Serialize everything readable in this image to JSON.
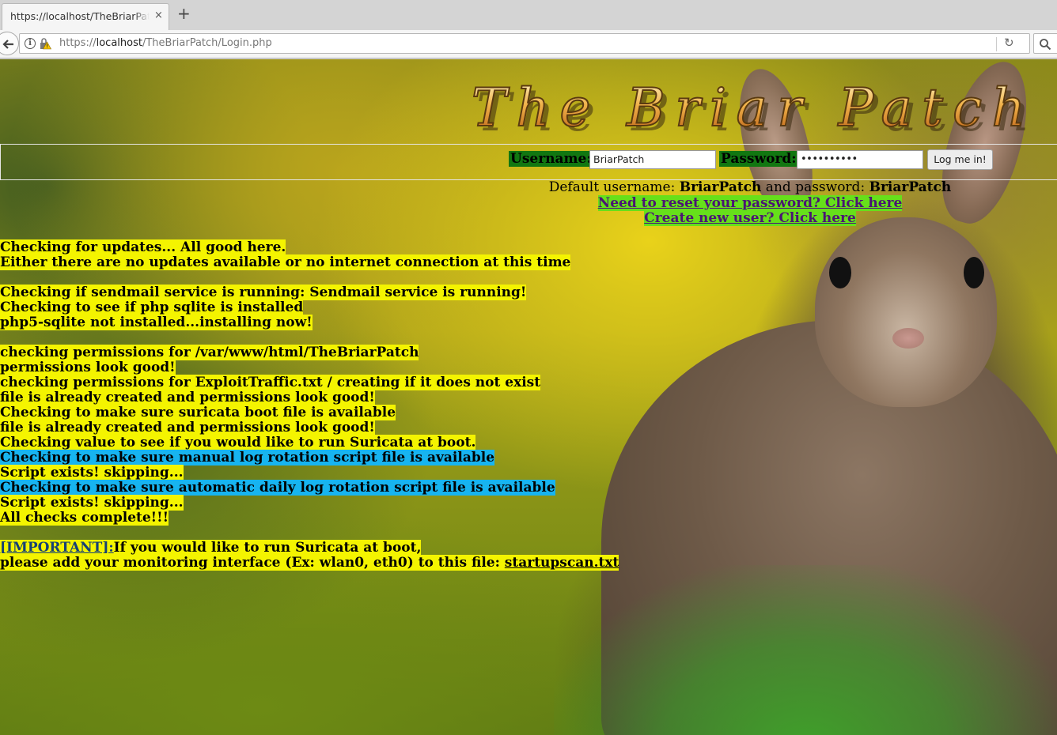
{
  "browser": {
    "tab_title": "https://localhost/TheBriarPatch",
    "tab_close": "×",
    "new_tab": "+",
    "url_scheme": "https://",
    "url_host": "localhost",
    "url_path": "/TheBriarPatch/Login.php"
  },
  "logo": {
    "text": "The Briar Patch"
  },
  "login": {
    "username_label": "Username:",
    "username_value": "BriarPatch",
    "password_label": "Password:",
    "password_value": "••••••••••",
    "submit_label": "Log me in!"
  },
  "defaults": {
    "prefix": "Default username: ",
    "username": "BriarPatch",
    "middle": " and password: ",
    "password": "BriarPatch"
  },
  "links": {
    "reset_password": "Need to reset your password? Click here",
    "create_user": "Create new user? Click here"
  },
  "messages": {
    "m1": "Checking for updates... All good here.",
    "m2": "Either there are no updates available or no internet connection at this time",
    "m3": "Checking if sendmail service is running: Sendmail service is running!",
    "m4": "Checking to see if php sqlite is installed",
    "m5": "php5-sqlite not installed...installing now!",
    "m6": "checking permissions for /var/www/html/TheBriarPatch",
    "m7": "permissions look good!",
    "m8": "checking permissions for ExploitTraffic.txt / creating if it does not exist",
    "m9": "file is already created and permissions look good!",
    "m10": "Checking to make sure suricata boot file is available",
    "m11": "file is already created and permissions look good!",
    "m12": "Checking value to see if you would like to run Suricata at boot.",
    "m13": "Checking to make sure manual log rotation script file is available",
    "m14": "Script exists! skipping...",
    "m15": "Checking to make sure automatic daily log rotation script file is available",
    "m16": "Script exists! skipping...",
    "m17": "All checks complete!!!",
    "important_tag": "[IMPORTANT]:",
    "important_text": "If you would like to run Suricata at boot,",
    "interface_text": "please add your monitoring interface (Ex: wlan0, eth0) to this file: ",
    "interface_link": "startupscan.txt"
  },
  "colors": {
    "highlight_yellow": "#f4f400",
    "highlight_blue": "#17b4f0",
    "label_green": "#117711",
    "link_green": "#66e01a"
  }
}
